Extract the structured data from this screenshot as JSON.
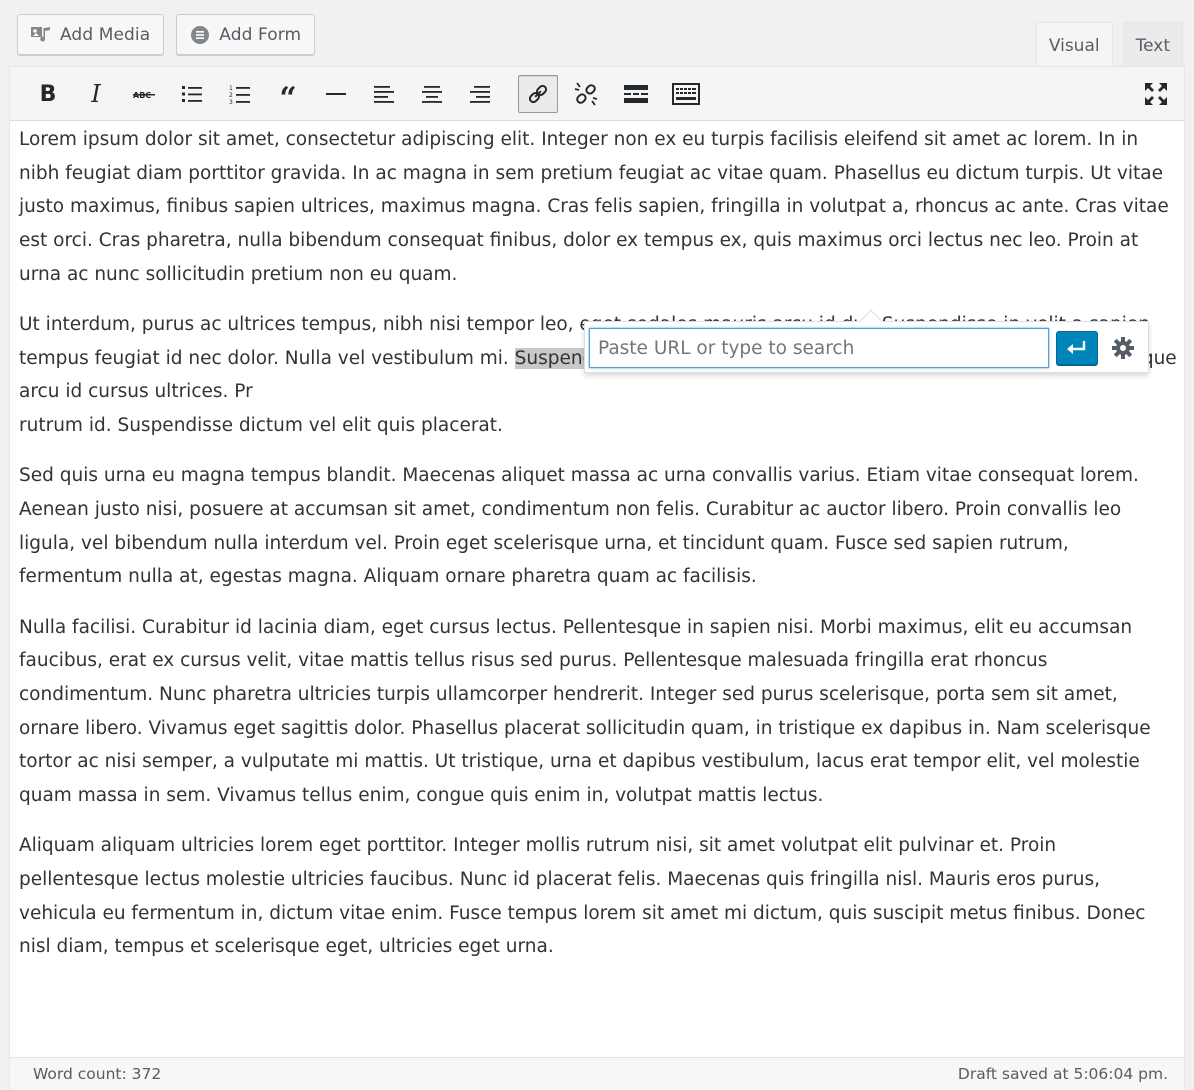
{
  "media_buttons": {
    "add_media": "Add Media",
    "add_form": "Add Form"
  },
  "tabs": {
    "visual": "Visual",
    "text": "Text",
    "active": "visual"
  },
  "toolbar": {
    "buttons": [
      "bold",
      "italic",
      "strikethrough",
      "bulleted-list",
      "numbered-list",
      "blockquote",
      "horizontal-line",
      "align-left",
      "align-center",
      "align-right",
      "insert-link",
      "remove-link",
      "read-more",
      "toolbar-toggle",
      "fullscreen"
    ],
    "pressed": "insert-link"
  },
  "content": {
    "p1": "Lorem ipsum dolor sit amet, consectetur adipiscing elit. Integer non ex eu turpis facilisis eleifend sit amet ac lorem. In in nibh feugiat diam porttitor gravida. In ac magna in sem pretium feugiat ac vitae quam. Phasellus eu dictum turpis. Ut vitae justo maximus, finibus sapien ultrices, maximus magna. Cras felis sapien, fringilla in volutpat a, rhoncus ac ante. Cras vitae est orci. Cras pharetra, nulla bibendum consequat finibus, dolor ex tempus ex, quis maximus orci lectus nec leo. Proin at urna ac nunc sollicitudin pretium non eu quam.",
    "p2_before": "Ut interdum, purus ac ultrices tempus, nibh nisi tempor leo, eget sodales mauris arcu id dui. Suspendisse in velit a sapien tempus feugiat id nec dolor. Nulla vel vestibulum mi. ",
    "p2_selected": "Suspendisse fermentum turpis",
    "p2_after": " ac laoreet mattis. Maecenas scelerisque arcu id cursus ultrices. Pr",
    "p2_end": "rutrum id. Suspendisse dictum vel elit quis placerat.",
    "p3": "Sed quis urna eu magna tempus blandit. Maecenas aliquet massa ac urna convallis varius. Etiam vitae consequat lorem. Aenean justo nisi, posuere at accumsan sit amet, condimentum non felis. Curabitur ac auctor libero. Proin convallis leo ligula, vel bibendum nulla interdum vel. Proin eget scelerisque urna, et tincidunt quam. Fusce sed sapien rutrum, fermentum nulla at, egestas magna. Aliquam ornare pharetra quam ac facilisis.",
    "p4": "Nulla facilisi. Curabitur id lacinia diam, eget cursus lectus. Pellentesque in sapien nisi. Morbi maximus, elit eu accumsan faucibus, erat ex cursus velit, vitae mattis tellus risus sed purus. Pellentesque malesuada fringilla erat rhoncus condimentum. Nunc pharetra ultricies turpis ullamcorper hendrerit. Integer sed purus scelerisque, porta sem sit amet, ornare libero. Vivamus eget sagittis dolor. Phasellus placerat sollicitudin quam, in tristique ex dapibus in. Nam scelerisque tortor ac nisi semper, a vulputate mi mattis. Ut tristique, urna et dapibus vestibulum, lacus erat tempor elit, vel molestie quam massa in sem. Vivamus tellus enim, congue quis enim in, volutpat mattis lectus.",
    "p5": "Aliquam aliquam ultricies lorem eget porttitor. Integer mollis rutrum nisi, sit amet volutpat elit pulvinar et. Proin pellentesque lectus molestie ultricies faucibus. Nunc id placerat felis. Maecenas quis fringilla nisl. Mauris eros purus, vehicula eu fermentum in, dictum vitae enim. Fusce tempus lorem sit amet mi dictum, quis suscipit metus finibus. Donec nisl diam, tempus et scelerisque eget, ultricies eget urna."
  },
  "link_popup": {
    "placeholder": "Paste URL or type to search",
    "value": ""
  },
  "status": {
    "word_count": "Word count: 372",
    "draft_saved": "Draft saved at 5:06:04 pm."
  },
  "colors": {
    "accent": "#0085ba",
    "spellcheck": "#d62d2d",
    "selection": "#c8c8c8"
  }
}
